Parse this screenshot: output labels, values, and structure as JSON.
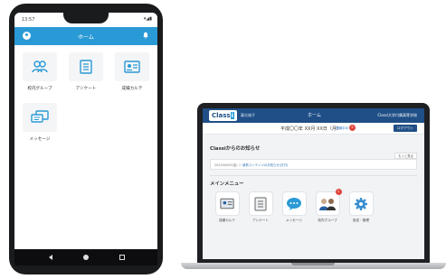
{
  "phone": {
    "status_time": "13:57",
    "status_icons": "▾◢▮",
    "app_title": "ホーム",
    "menu": [
      {
        "label": "校内グループ",
        "icon": "group-icon"
      },
      {
        "label": "アンケート",
        "icon": "survey-icon"
      },
      {
        "label": "成績カルテ",
        "icon": "grade-card-icon"
      },
      {
        "label": "メッセージ",
        "icon": "message-icon"
      }
    ]
  },
  "laptop": {
    "logo_text": "Class",
    "logo_i": "i",
    "header_user": "藤光雄子",
    "header_home": "ホーム",
    "header_school": "Classi大学付属高等学校",
    "date": "平成〇〇年 XX月 XX日（月）",
    "notice_link": "連絡中の 0件",
    "notice_badge": "5",
    "logout": "ログアウト",
    "news_title": "Classiからのお知らせ",
    "news_more": "もっと見る",
    "news_date": "2020/00/00(金)",
    "news_text": "新着コンテンツのお知らせ(日付)",
    "main_menu_title": "メインメニュー",
    "menu": [
      {
        "label": "成績カルテ",
        "icon": "grade-card-icon"
      },
      {
        "label": "アンケート",
        "icon": "survey-icon"
      },
      {
        "label": "メッセージ",
        "icon": "message-icon"
      },
      {
        "label": "校内グループ",
        "icon": "group-icon",
        "badge": "1"
      },
      {
        "label": "設定・管理",
        "icon": "gear-icon"
      }
    ]
  },
  "colors": {
    "app_bar": "#2a9ad6",
    "web_header": "#1f4f86",
    "badge": "#e0443c"
  }
}
